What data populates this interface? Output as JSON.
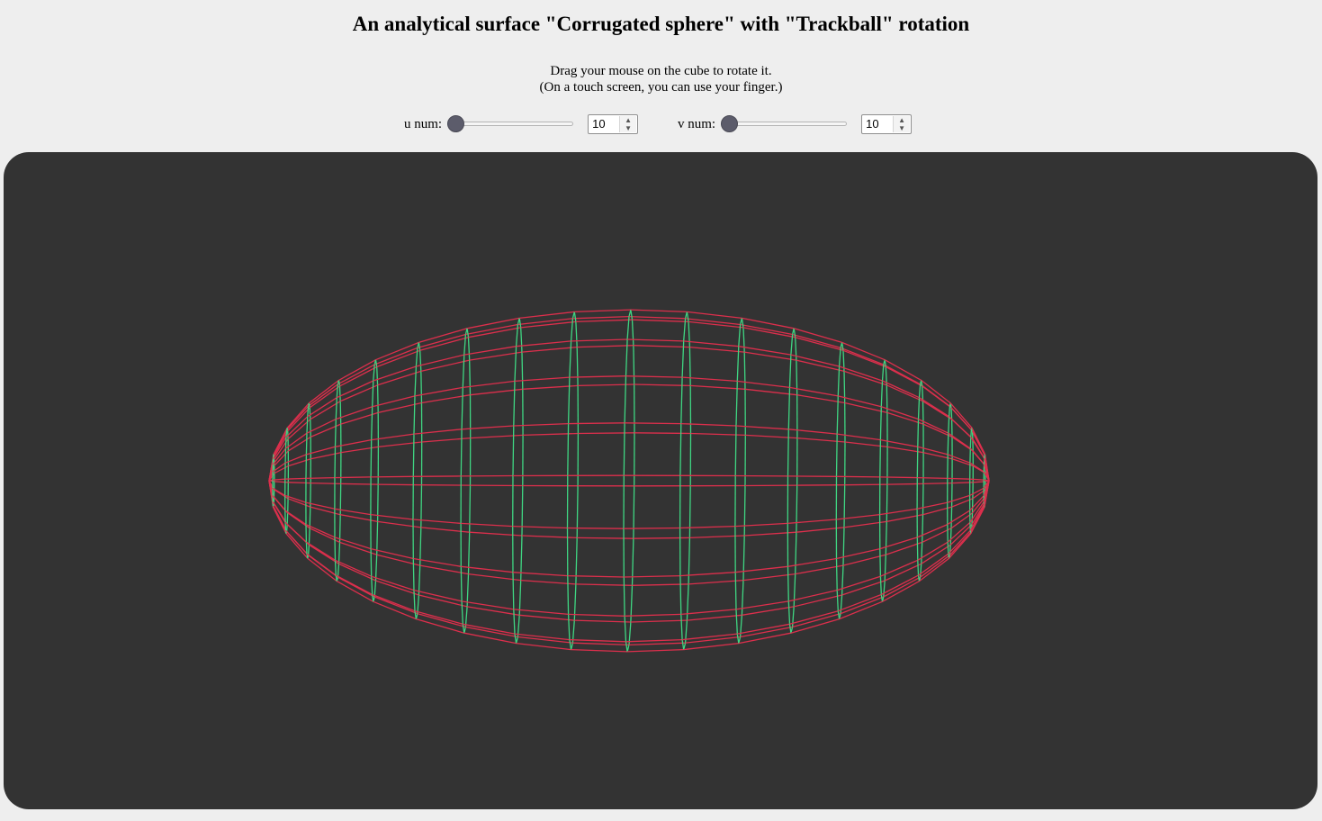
{
  "page": {
    "title": "An analytical surface \"Corrugated sphere\" with \"Trackball\" rotation",
    "instructions": [
      "Drag your mouse on the cube to rotate it.",
      "(On a touch screen, you can use your finger.)"
    ]
  },
  "controls": {
    "u": {
      "label": "u num:",
      "value": "10",
      "slider_fraction": 0.0
    },
    "v": {
      "label": "v num:",
      "value": "10",
      "slider_fraction": 0.0
    }
  },
  "canvas": {
    "background": "#333333",
    "u_line_color": "#dc2f4c",
    "v_line_color": "#3fd682",
    "u_num": 10,
    "v_num": 10
  }
}
